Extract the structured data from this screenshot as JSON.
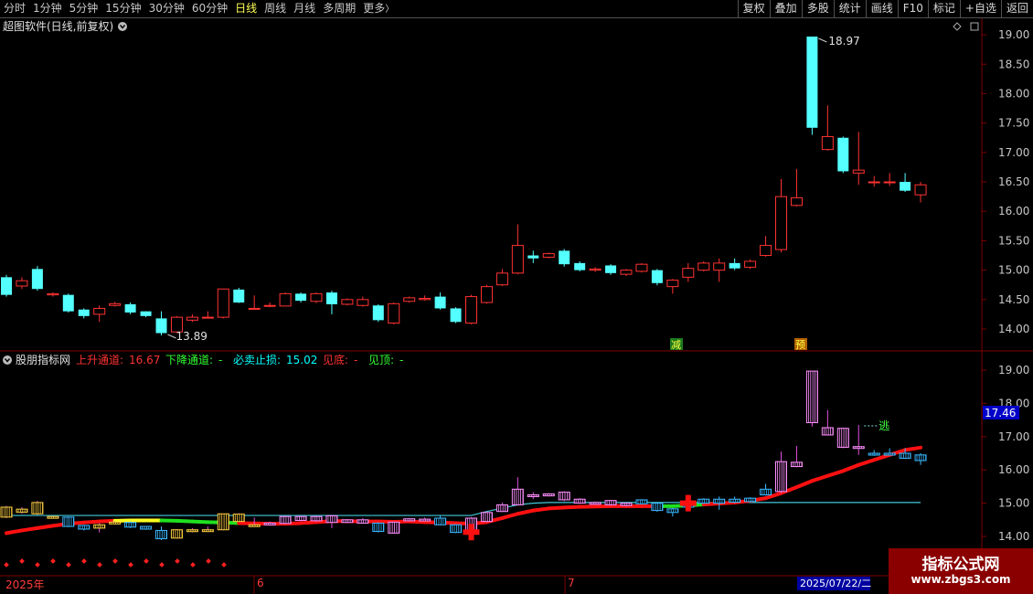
{
  "toolbar": {
    "periods": [
      {
        "label": "分时",
        "active": false
      },
      {
        "label": "1分钟",
        "active": false
      },
      {
        "label": "5分钟",
        "active": false
      },
      {
        "label": "15分钟",
        "active": false
      },
      {
        "label": "30分钟",
        "active": false
      },
      {
        "label": "60分钟",
        "active": false
      },
      {
        "label": "日线",
        "active": true
      },
      {
        "label": "周线",
        "active": false
      },
      {
        "label": "月线",
        "active": false
      },
      {
        "label": "多周期",
        "active": false
      }
    ],
    "more_label": "更多",
    "more_glyph": "〉",
    "buttons": [
      "复权",
      "叠加",
      "多股",
      "统计",
      "画线",
      "F10",
      "标记",
      "+自选",
      "返回"
    ]
  },
  "main_panel": {
    "title": "超图软件(日线,前复权)",
    "y_ticks": [
      "19.00",
      "18.50",
      "18.00",
      "17.50",
      "17.00",
      "16.50",
      "16.00",
      "15.50",
      "15.00",
      "14.50",
      "14.00"
    ],
    "high_label": "18.97",
    "low_label": "13.89",
    "signal_jian": "减",
    "signal_yu": "预"
  },
  "indicator_panel": {
    "name": "股朋指标网",
    "readouts": [
      {
        "label": "上升通道:",
        "value": "16.67",
        "color": "#ff3232"
      },
      {
        "label": "下降通道:",
        "value": "-",
        "color": "#32ff32"
      },
      {
        "label": "必卖止损:",
        "value": "15.02",
        "color": "#00ffff"
      },
      {
        "label": "见底:",
        "value": "-",
        "color": "#ff3232"
      },
      {
        "label": "见顶:",
        "value": "-",
        "color": "#32ff32"
      }
    ],
    "y_ticks": [
      "19.00",
      "18.00",
      "17.00",
      "16.00",
      "15.00",
      "14.00"
    ],
    "current_price": "17.46",
    "escape_label": "逃"
  },
  "date_axis": {
    "labels": [
      "2025年",
      "6",
      "7"
    ],
    "cursor_date": "2025/07/22/二"
  },
  "watermark": {
    "line1": "指标公式网",
    "line2": "www.zbgs3.com"
  },
  "colors": {
    "up": "#ff3232",
    "down": "#54ffff",
    "grid": "#800000",
    "axis_text": "#c8c8c8",
    "channel_up": "#ff1010",
    "stop_line": "#40c8d8"
  },
  "chart_data": {
    "type": "candlestick",
    "title": "超图软件(日线,前复权)",
    "ylim": [
      13.7,
      19.25
    ],
    "x_labels": [
      "2025年",
      "6",
      "7"
    ],
    "candles": [
      [
        14.88,
        14.58,
        14.92,
        14.55
      ],
      [
        14.73,
        14.82,
        14.88,
        14.68
      ],
      [
        15.02,
        14.68,
        15.07,
        14.65
      ],
      [
        14.58,
        14.6,
        14.62,
        14.55
      ],
      [
        14.58,
        14.3,
        14.6,
        14.28
      ],
      [
        14.33,
        14.22,
        14.35,
        14.18
      ],
      [
        14.25,
        14.35,
        14.4,
        14.12
      ],
      [
        14.4,
        14.43,
        14.46,
        14.38
      ],
      [
        14.42,
        14.28,
        14.45,
        14.25
      ],
      [
        14.3,
        14.22,
        14.3,
        14.2
      ],
      [
        14.18,
        13.93,
        14.3,
        13.89
      ],
      [
        13.95,
        14.2,
        14.22,
        13.93
      ],
      [
        14.15,
        14.2,
        14.25,
        14.12
      ],
      [
        14.2,
        14.2,
        14.3,
        14.18
      ],
      [
        14.2,
        14.68,
        14.68,
        14.18
      ],
      [
        14.67,
        14.45,
        14.7,
        14.44
      ],
      [
        14.35,
        14.35,
        14.57,
        14.33
      ],
      [
        14.4,
        14.4,
        14.45,
        14.37
      ],
      [
        14.39,
        14.6,
        14.62,
        14.39
      ],
      [
        14.6,
        14.48,
        14.62,
        14.45
      ],
      [
        14.47,
        14.6,
        14.62,
        14.44
      ],
      [
        14.62,
        14.42,
        14.65,
        14.25
      ],
      [
        14.42,
        14.5,
        14.52,
        14.4
      ],
      [
        14.4,
        14.5,
        14.55,
        14.38
      ],
      [
        14.4,
        14.15,
        14.42,
        14.12
      ],
      [
        14.1,
        14.43,
        14.45,
        14.08
      ],
      [
        14.47,
        14.53,
        14.55,
        14.45
      ],
      [
        14.5,
        14.52,
        14.57,
        14.48
      ],
      [
        14.55,
        14.35,
        14.62,
        14.33
      ],
      [
        14.35,
        14.12,
        14.37,
        14.1
      ],
      [
        14.1,
        14.55,
        14.58,
        14.08
      ],
      [
        14.45,
        14.72,
        14.75,
        14.43
      ],
      [
        14.75,
        14.95,
        15.02,
        14.73
      ],
      [
        14.95,
        15.42,
        15.78,
        14.93
      ],
      [
        15.25,
        15.2,
        15.33,
        15.12
      ],
      [
        15.22,
        15.28,
        15.3,
        15.2
      ],
      [
        15.33,
        15.1,
        15.36,
        15.06
      ],
      [
        15.12,
        15.0,
        15.15,
        14.98
      ],
      [
        15.0,
        15.02,
        15.05,
        14.97
      ],
      [
        15.08,
        14.95,
        15.1,
        14.92
      ],
      [
        14.93,
        15.0,
        15.02,
        14.9
      ],
      [
        14.98,
        15.1,
        15.12,
        14.96
      ],
      [
        15.0,
        14.78,
        15.02,
        14.74
      ],
      [
        14.72,
        14.83,
        14.85,
        14.6
      ],
      [
        14.88,
        15.03,
        15.12,
        14.8
      ],
      [
        15.0,
        15.12,
        15.15,
        14.98
      ],
      [
        15.0,
        15.12,
        15.2,
        14.8
      ],
      [
        15.12,
        15.03,
        15.2,
        15.0
      ],
      [
        15.05,
        15.15,
        15.18,
        15.02
      ],
      [
        15.25,
        15.42,
        15.58,
        15.23
      ],
      [
        15.35,
        16.25,
        16.55,
        15.3
      ],
      [
        16.1,
        16.23,
        16.72,
        16.08
      ],
      [
        18.97,
        17.42,
        18.97,
        17.3
      ],
      [
        17.05,
        17.27,
        17.8,
        17.03
      ],
      [
        17.25,
        16.68,
        17.27,
        16.65
      ],
      [
        16.65,
        16.7,
        17.35,
        16.45
      ],
      [
        16.5,
        16.5,
        16.6,
        16.42
      ],
      [
        16.5,
        16.5,
        16.65,
        16.43
      ],
      [
        16.5,
        16.35,
        16.65,
        16.33
      ],
      [
        16.28,
        16.45,
        16.5,
        16.15
      ]
    ],
    "indicator": {
      "name": "股朋指标网",
      "ylim": [
        13.75,
        19.35
      ],
      "series": [
        {
          "name": "上升通道",
          "values": [
            14.1,
            14.18,
            14.25,
            14.32,
            14.38,
            14.42,
            14.45,
            14.47,
            14.48,
            14.48,
            14.48,
            14.47,
            14.45,
            14.43,
            14.42,
            14.4,
            14.39,
            14.38,
            14.38,
            14.4,
            14.43,
            14.46,
            14.46,
            14.45,
            14.45,
            14.44,
            14.45,
            14.43,
            14.42,
            14.4,
            14.38,
            14.43,
            14.55,
            14.68,
            14.78,
            14.84,
            14.87,
            14.89,
            14.9,
            14.91,
            14.91,
            14.91,
            14.91,
            14.91,
            14.93,
            14.96,
            14.99,
            15.02,
            15.07,
            15.15,
            15.3,
            15.48,
            15.67,
            15.82,
            15.97,
            16.15,
            16.3,
            16.45,
            16.6,
            16.67
          ]
        },
        {
          "name": "必卖止损",
          "values": [
            14.63,
            14.63,
            14.63,
            14.63,
            14.63,
            14.63,
            14.63,
            14.63,
            14.63,
            14.63,
            14.63,
            14.63,
            14.63,
            14.63,
            14.63,
            14.63,
            14.63,
            14.63,
            14.63,
            14.63,
            14.63,
            14.63,
            14.63,
            14.63,
            14.63,
            14.63,
            14.63,
            14.63,
            14.63,
            14.63,
            14.63,
            14.75,
            14.85,
            14.95,
            15.0,
            15.02,
            15.02,
            15.02,
            15.02,
            15.02,
            15.02,
            15.02,
            15.02,
            15.02,
            15.02,
            15.02,
            15.02,
            15.02,
            15.02,
            15.02,
            15.02,
            15.02,
            15.02,
            15.02,
            15.02,
            15.02,
            15.02,
            15.02,
            15.02,
            15.02
          ]
        }
      ]
    }
  }
}
